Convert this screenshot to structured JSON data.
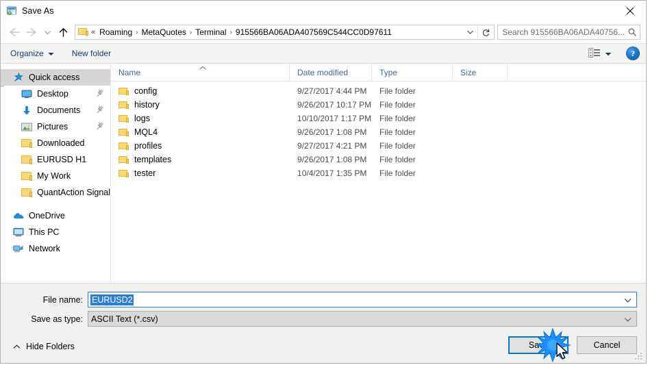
{
  "window": {
    "title": "Save As",
    "icon": "metatrader-app-icon",
    "close_label": "✕"
  },
  "nav": {
    "back_label": "Back",
    "forward_label": "Forward",
    "recent_label": "Recent locations",
    "up_label": "Up one level",
    "refresh_label": "Refresh",
    "breadcrumb_prefix": "«",
    "breadcrumbs": [
      "Roaming",
      "MetaQuotes",
      "Terminal",
      "915566BA06ADA407569C544CC0D97611"
    ],
    "separator": "›"
  },
  "search": {
    "placeholder": "Search 915566BA06ADA40756...",
    "icon": "search-icon"
  },
  "toolbar": {
    "organize_label": "Organize",
    "new_folder_label": "New folder",
    "view_icon": "view-layout-icon",
    "help_label": "?"
  },
  "sidebar": {
    "items": [
      {
        "label": "Quick access",
        "icon": "star-pin-icon",
        "selected": true,
        "indent": false,
        "pinned": false
      },
      {
        "label": "Desktop",
        "icon": "desktop-icon",
        "selected": false,
        "indent": true,
        "pinned": true
      },
      {
        "label": "Documents",
        "icon": "documents-icon",
        "selected": false,
        "indent": true,
        "pinned": true
      },
      {
        "label": "Pictures",
        "icon": "pictures-icon",
        "selected": false,
        "indent": true,
        "pinned": true
      },
      {
        "label": "Downloaded",
        "icon": "folder-icon",
        "selected": false,
        "indent": true,
        "pinned": false
      },
      {
        "label": "EURUSD H1",
        "icon": "folder-icon",
        "selected": false,
        "indent": true,
        "pinned": false
      },
      {
        "label": "My Work",
        "icon": "folder-icon",
        "selected": false,
        "indent": true,
        "pinned": false
      },
      {
        "label": "QuantAction Signal",
        "icon": "folder-icon",
        "selected": false,
        "indent": true,
        "pinned": false
      }
    ],
    "groups": [
      {
        "label": "OneDrive",
        "icon": "onedrive-cloud-icon"
      },
      {
        "label": "This PC",
        "icon": "this-pc-icon"
      },
      {
        "label": "Network",
        "icon": "network-icon"
      }
    ]
  },
  "filelist": {
    "columns": [
      "Name",
      "Date modified",
      "Type",
      "Size"
    ],
    "sorted_by": "Name",
    "sort_direction": "ascending",
    "rows": [
      {
        "name": "config",
        "date": "9/27/2017 4:44 PM",
        "type": "File folder",
        "size": ""
      },
      {
        "name": "history",
        "date": "9/26/2017 10:17 PM",
        "type": "File folder",
        "size": ""
      },
      {
        "name": "logs",
        "date": "10/10/2017 1:17 PM",
        "type": "File folder",
        "size": ""
      },
      {
        "name": "MQL4",
        "date": "9/26/2017 1:08 PM",
        "type": "File folder",
        "size": ""
      },
      {
        "name": "profiles",
        "date": "9/27/2017 4:21 PM",
        "type": "File folder",
        "size": ""
      },
      {
        "name": "templates",
        "date": "9/26/2017 1:08 PM",
        "type": "File folder",
        "size": ""
      },
      {
        "name": "tester",
        "date": "10/4/2017 1:35 PM",
        "type": "File folder",
        "size": ""
      }
    ]
  },
  "form": {
    "filename_label": "File name:",
    "filename_value": "EURUSD2",
    "filetype_label": "Save as type:",
    "filetype_value": "ASCII Text (*.csv)"
  },
  "footer": {
    "hide_folders_label": "Hide Folders",
    "save_label": "Save",
    "cancel_label": "Cancel"
  },
  "colors": {
    "accent": "#0078d7",
    "selection": "#2a7fd4",
    "header_text": "#41689e",
    "toolbar_bg": "#f3f3f3",
    "footer_bg": "#f0f0f0",
    "folder_yellow": "#fcd77a"
  }
}
